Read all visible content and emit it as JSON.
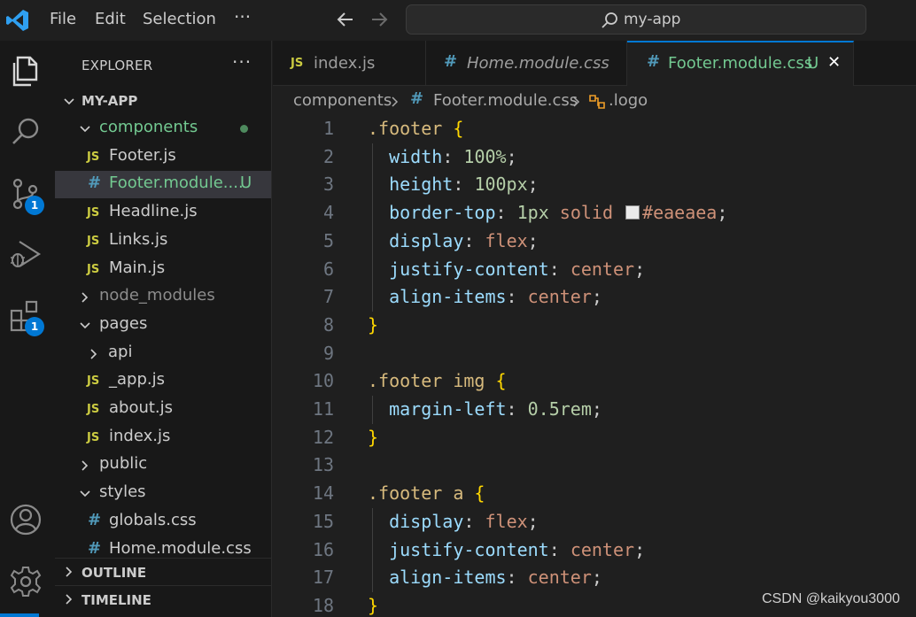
{
  "titlebar": {
    "menu": [
      "File",
      "Edit",
      "Selection"
    ],
    "more": "···",
    "search_text": "my-app"
  },
  "activitybar": {
    "items": [
      "explorer-icon",
      "search-icon",
      "source-control-icon",
      "run-debug-icon",
      "extensions-icon",
      "account-icon",
      "settings-icon"
    ],
    "source_control_badge": "1",
    "extensions_badge": "1"
  },
  "sidebar": {
    "title": "EXPLORER",
    "more": "···",
    "root": "MY-APP",
    "tree": [
      {
        "label": "components",
        "type": "folder",
        "open": true,
        "depth": 1,
        "modified": true
      },
      {
        "label": "Footer.js",
        "type": "js",
        "depth": 2
      },
      {
        "label": "Footer.module....",
        "type": "css",
        "depth": 2,
        "selected": true,
        "status": "U"
      },
      {
        "label": "Headline.js",
        "type": "js",
        "depth": 2
      },
      {
        "label": "Links.js",
        "type": "js",
        "depth": 2
      },
      {
        "label": "Main.js",
        "type": "js",
        "depth": 2
      },
      {
        "label": "node_modules",
        "type": "folder",
        "open": false,
        "depth": 1,
        "dim": true
      },
      {
        "label": "pages",
        "type": "folder",
        "open": true,
        "depth": 1
      },
      {
        "label": "api",
        "type": "folder",
        "open": false,
        "depth": 2
      },
      {
        "label": "_app.js",
        "type": "js",
        "depth": 2
      },
      {
        "label": "about.js",
        "type": "js",
        "depth": 2
      },
      {
        "label": "index.js",
        "type": "js",
        "depth": 2
      },
      {
        "label": "public",
        "type": "folder",
        "open": false,
        "depth": 1
      },
      {
        "label": "styles",
        "type": "folder",
        "open": true,
        "depth": 1
      },
      {
        "label": "globals.css",
        "type": "css",
        "depth": 2
      },
      {
        "label": "Home.module.css",
        "type": "css",
        "depth": 2
      }
    ],
    "outline": "OUTLINE",
    "timeline": "TIMELINE"
  },
  "tabs": [
    {
      "label": "index.js",
      "icon": "JS"
    },
    {
      "label": "Home.module.css",
      "icon": "#"
    },
    {
      "label": "Footer.module.css",
      "icon": "#",
      "status": "U",
      "close": "✕"
    }
  ],
  "breadcrumb": {
    "folder": "components",
    "file": "Footer.module.css",
    "symbol": ".logo"
  },
  "editor": {
    "line_numbers": [
      "1",
      "2",
      "3",
      "4",
      "5",
      "6",
      "7",
      "8",
      "9",
      "10",
      "11",
      "12",
      "13",
      "14",
      "15",
      "16",
      "17",
      "18"
    ],
    "lines": [
      [
        [
          "sel",
          ".footer"
        ],
        [
          "sp",
          " "
        ],
        [
          "brace",
          "{"
        ]
      ],
      [
        [
          "ind",
          "  "
        ],
        [
          "prop",
          "width"
        ],
        [
          "punc",
          ": "
        ],
        [
          "num",
          "100%"
        ],
        [
          "punc",
          ";"
        ]
      ],
      [
        [
          "ind",
          "  "
        ],
        [
          "prop",
          "height"
        ],
        [
          "punc",
          ": "
        ],
        [
          "num",
          "100px"
        ],
        [
          "punc",
          ";"
        ]
      ],
      [
        [
          "ind",
          "  "
        ],
        [
          "prop",
          "border-top"
        ],
        [
          "punc",
          ": "
        ],
        [
          "num",
          "1px"
        ],
        [
          "sp",
          " "
        ],
        [
          "val",
          "solid"
        ],
        [
          "sp",
          " "
        ],
        [
          "swatch",
          ""
        ],
        [
          "val",
          "#eaeaea"
        ],
        [
          "punc",
          ";"
        ]
      ],
      [
        [
          "ind",
          "  "
        ],
        [
          "prop",
          "display"
        ],
        [
          "punc",
          ": "
        ],
        [
          "val",
          "flex"
        ],
        [
          "punc",
          ";"
        ]
      ],
      [
        [
          "ind",
          "  "
        ],
        [
          "prop",
          "justify-content"
        ],
        [
          "punc",
          ": "
        ],
        [
          "val",
          "center"
        ],
        [
          "punc",
          ";"
        ]
      ],
      [
        [
          "ind",
          "  "
        ],
        [
          "prop",
          "align-items"
        ],
        [
          "punc",
          ": "
        ],
        [
          "val",
          "center"
        ],
        [
          "punc",
          ";"
        ]
      ],
      [
        [
          "brace",
          "}"
        ]
      ],
      [],
      [
        [
          "sel",
          ".footer img"
        ],
        [
          "sp",
          " "
        ],
        [
          "brace",
          "{"
        ]
      ],
      [
        [
          "ind",
          "  "
        ],
        [
          "prop",
          "margin-left"
        ],
        [
          "punc",
          ": "
        ],
        [
          "num",
          "0.5rem"
        ],
        [
          "punc",
          ";"
        ]
      ],
      [
        [
          "brace",
          "}"
        ]
      ],
      [],
      [
        [
          "sel",
          ".footer a"
        ],
        [
          "sp",
          " "
        ],
        [
          "brace",
          "{"
        ]
      ],
      [
        [
          "ind",
          "  "
        ],
        [
          "prop",
          "display"
        ],
        [
          "punc",
          ": "
        ],
        [
          "val",
          "flex"
        ],
        [
          "punc",
          ";"
        ]
      ],
      [
        [
          "ind",
          "  "
        ],
        [
          "prop",
          "justify-content"
        ],
        [
          "punc",
          ": "
        ],
        [
          "val",
          "center"
        ],
        [
          "punc",
          ";"
        ]
      ],
      [
        [
          "ind",
          "  "
        ],
        [
          "prop",
          "align-items"
        ],
        [
          "punc",
          ": "
        ],
        [
          "val",
          "center"
        ],
        [
          "punc",
          ";"
        ]
      ],
      [
        [
          "brace",
          "}"
        ]
      ]
    ]
  },
  "watermark": "CSDN @kaikyou3000",
  "colors": {
    "accent": "#0078d4",
    "modified": "#73c991",
    "js": "#cbcb41",
    "css": "#519aba"
  }
}
